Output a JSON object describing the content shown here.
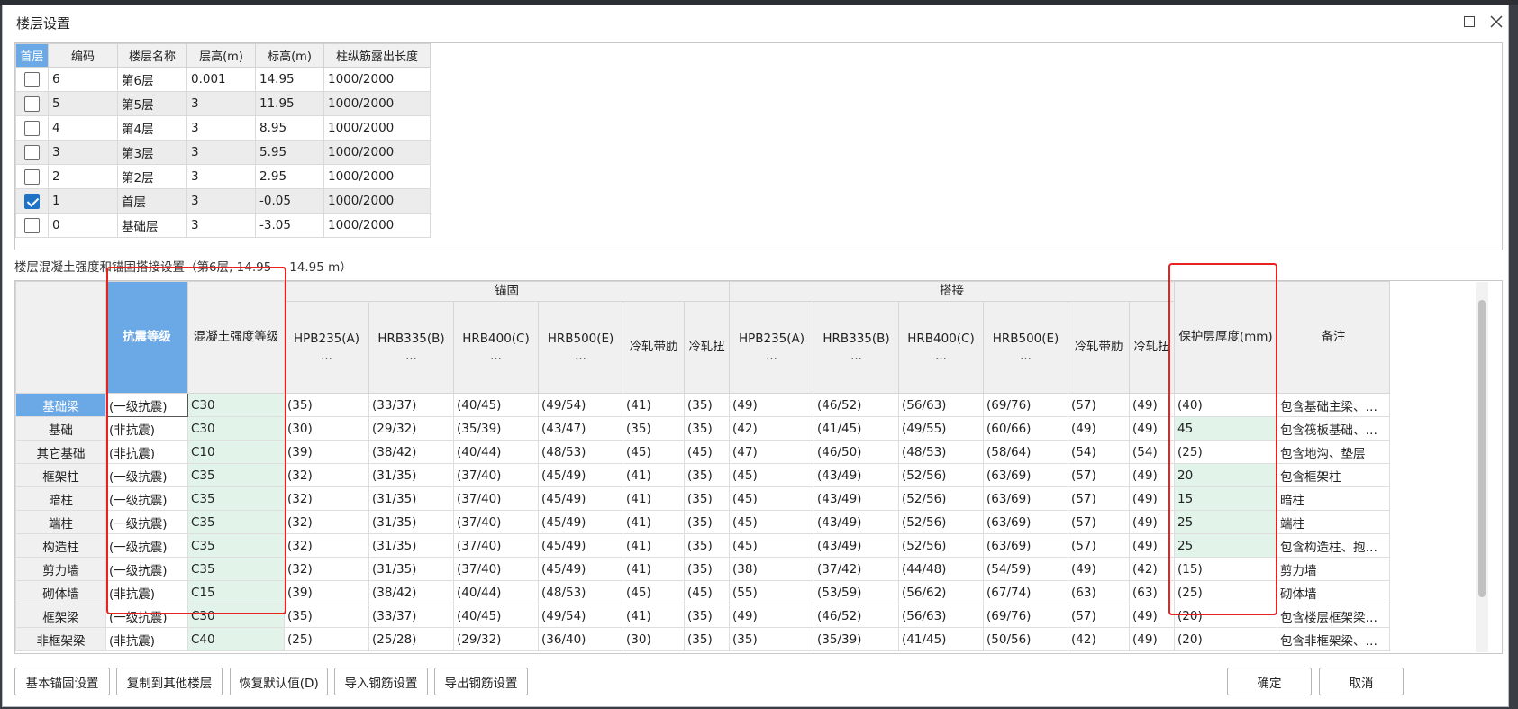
{
  "dialog": {
    "title": "楼层设置"
  },
  "floors": {
    "headers": [
      "首层",
      "编码",
      "楼层名称",
      "层高(m)",
      "标高(m)",
      "柱纵筋露出长度"
    ],
    "rows": [
      {
        "checked": false,
        "code": "6",
        "name": "第6层",
        "height": "0.001",
        "elevation": "14.95",
        "exposed": "1000/2000"
      },
      {
        "checked": false,
        "code": "5",
        "name": "第5层",
        "height": "3",
        "elevation": "11.95",
        "exposed": "1000/2000"
      },
      {
        "checked": false,
        "code": "4",
        "name": "第4层",
        "height": "3",
        "elevation": "8.95",
        "exposed": "1000/2000"
      },
      {
        "checked": false,
        "code": "3",
        "name": "第3层",
        "height": "3",
        "elevation": "5.95",
        "exposed": "1000/2000"
      },
      {
        "checked": false,
        "code": "2",
        "name": "第2层",
        "height": "3",
        "elevation": "2.95",
        "exposed": "1000/2000"
      },
      {
        "checked": true,
        "code": "1",
        "name": "首层",
        "height": "3",
        "elevation": "-0.05",
        "exposed": "1000/2000"
      },
      {
        "checked": false,
        "code": "0",
        "name": "基础层",
        "height": "3",
        "elevation": "-3.05",
        "exposed": "1000/2000"
      }
    ]
  },
  "section_label": "楼层混凝土强度和锚固搭接设置（第6层, 14.95 ~ 14.95 m）",
  "settings": {
    "group_anchor": "锚固",
    "group_lap": "搭接",
    "col_seismic": "抗震等级",
    "col_concrete": "混凝土强度等级",
    "anchor_cols": [
      {
        "label": "HPB235(A)",
        "dots": "..."
      },
      {
        "label": "HRB335(B)",
        "dots": "..."
      },
      {
        "label": "HRB400(C)",
        "dots": "..."
      },
      {
        "label": "HRB500(E)",
        "dots": "..."
      },
      {
        "label": "冷轧带肋",
        "dots": ""
      },
      {
        "label": "冷轧扭",
        "dots": ""
      }
    ],
    "lap_cols": [
      {
        "label": "HPB235(A)",
        "dots": "..."
      },
      {
        "label": "HRB335(B)",
        "dots": "..."
      },
      {
        "label": "HRB400(C)",
        "dots": "..."
      },
      {
        "label": "HRB500(E)",
        "dots": "..."
      },
      {
        "label": "冷轧带肋",
        "dots": ""
      },
      {
        "label": "冷轧扭",
        "dots": ""
      }
    ],
    "col_cover": "保护层厚度(mm)",
    "col_remark": "备注",
    "rows": [
      {
        "name": "基础梁",
        "seismic": "(一级抗震)",
        "concrete": "C30",
        "anchor": [
          "(35)",
          "(33/37)",
          "(40/45)",
          "(49/54)",
          "(41)",
          "(35)"
        ],
        "lap": [
          "(49)",
          "(46/52)",
          "(56/63)",
          "(69/76)",
          "(57)",
          "(49)"
        ],
        "cover": "(40)",
        "remark": "包含基础主梁、…"
      },
      {
        "name": "基础",
        "seismic": "(非抗震)",
        "concrete": "C30",
        "anchor": [
          "(30)",
          "(29/32)",
          "(35/39)",
          "(43/47)",
          "(35)",
          "(35)"
        ],
        "lap": [
          "(42)",
          "(41/45)",
          "(49/55)",
          "(60/66)",
          "(49)",
          "(49)"
        ],
        "cover": "45",
        "remark": "包含筏板基础、…"
      },
      {
        "name": "其它基础",
        "seismic": "(非抗震)",
        "concrete": "C10",
        "anchor": [
          "(39)",
          "(38/42)",
          "(40/44)",
          "(48/53)",
          "(45)",
          "(45)"
        ],
        "lap": [
          "(47)",
          "(46/50)",
          "(48/53)",
          "(58/64)",
          "(54)",
          "(54)"
        ],
        "cover": "(25)",
        "remark": "包含地沟、垫层"
      },
      {
        "name": "框架柱",
        "seismic": "(一级抗震)",
        "concrete": "C35",
        "anchor": [
          "(32)",
          "(31/35)",
          "(37/40)",
          "(45/49)",
          "(41)",
          "(35)"
        ],
        "lap": [
          "(45)",
          "(43/49)",
          "(52/56)",
          "(63/69)",
          "(57)",
          "(49)"
        ],
        "cover": "20",
        "remark": "包含框架柱"
      },
      {
        "name": "暗柱",
        "seismic": "(一级抗震)",
        "concrete": "C35",
        "anchor": [
          "(32)",
          "(31/35)",
          "(37/40)",
          "(45/49)",
          "(41)",
          "(35)"
        ],
        "lap": [
          "(45)",
          "(43/49)",
          "(52/56)",
          "(63/69)",
          "(57)",
          "(49)"
        ],
        "cover": "15",
        "remark": "暗柱"
      },
      {
        "name": "端柱",
        "seismic": "(一级抗震)",
        "concrete": "C35",
        "anchor": [
          "(32)",
          "(31/35)",
          "(37/40)",
          "(45/49)",
          "(41)",
          "(35)"
        ],
        "lap": [
          "(45)",
          "(43/49)",
          "(52/56)",
          "(63/69)",
          "(57)",
          "(49)"
        ],
        "cover": "25",
        "remark": "端柱"
      },
      {
        "name": "构造柱",
        "seismic": "(一级抗震)",
        "concrete": "C35",
        "anchor": [
          "(32)",
          "(31/35)",
          "(37/40)",
          "(45/49)",
          "(41)",
          "(35)"
        ],
        "lap": [
          "(45)",
          "(43/49)",
          "(52/56)",
          "(63/69)",
          "(57)",
          "(49)"
        ],
        "cover": "25",
        "remark": "包含构造柱、抱…"
      },
      {
        "name": "剪力墙",
        "seismic": "(一级抗震)",
        "concrete": "C35",
        "anchor": [
          "(32)",
          "(31/35)",
          "(37/40)",
          "(45/49)",
          "(41)",
          "(35)"
        ],
        "lap": [
          "(38)",
          "(37/42)",
          "(44/48)",
          "(54/59)",
          "(49)",
          "(42)"
        ],
        "cover": "(15)",
        "remark": "剪力墙"
      },
      {
        "name": "砌体墙",
        "seismic": "(非抗震)",
        "concrete": "C15",
        "anchor": [
          "(39)",
          "(38/42)",
          "(40/44)",
          "(48/53)",
          "(45)",
          "(45)"
        ],
        "lap": [
          "(55)",
          "(53/59)",
          "(56/62)",
          "(67/74)",
          "(63)",
          "(63)"
        ],
        "cover": "(25)",
        "remark": "砌体墙"
      },
      {
        "name": "框架梁",
        "seismic": "(一级抗震)",
        "concrete": "C30",
        "anchor": [
          "(35)",
          "(33/37)",
          "(40/45)",
          "(49/54)",
          "(41)",
          "(35)"
        ],
        "lap": [
          "(49)",
          "(46/52)",
          "(56/63)",
          "(69/76)",
          "(57)",
          "(49)"
        ],
        "cover": "(20)",
        "remark": "包含楼层框架梁…"
      },
      {
        "name": "非框架梁",
        "seismic": "(非抗震)",
        "concrete": "C40",
        "anchor": [
          "(25)",
          "(25/28)",
          "(29/32)",
          "(36/40)",
          "(30)",
          "(35)"
        ],
        "lap": [
          "(35)",
          "(35/39)",
          "(41/45)",
          "(50/56)",
          "(42)",
          "(49)"
        ],
        "cover": "(20)",
        "remark": "包含非框架梁、…"
      }
    ]
  },
  "buttons": {
    "basic_anchor": "基本锚固设置",
    "copy_to_floors": "复制到其他楼层",
    "restore_default": "恢复默认值(D)",
    "import_rebar": "导入钢筋设置",
    "export_rebar": "导出钢筋设置",
    "ok": "确定",
    "cancel": "取消"
  },
  "colors": {
    "accent": "#6aa8e6",
    "highlight_green": "#e2f4ea",
    "annotation_red": "#e8231e",
    "checkbox_blue": "#1e73c7"
  }
}
